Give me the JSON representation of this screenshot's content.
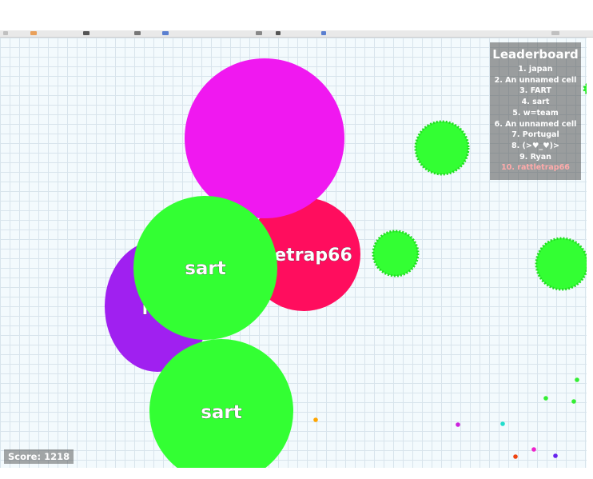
{
  "leaderboard": {
    "title": "Leaderboard",
    "entries": [
      "1. japan",
      "2. An unnamed cell",
      "3. FART",
      "4. sart",
      "5. w=team",
      "6. An unnamed cell",
      "7. Portugal",
      "8. (>♥_♥)>",
      "9. Ryan",
      "10. rattletrap66"
    ],
    "highlight_color": "#ffaaaa"
  },
  "score": {
    "text": "Score: 1218"
  },
  "cells": {
    "pink_big": {
      "color": "#f018f0"
    },
    "red_player": {
      "label": "etrap66",
      "color": "#ff0d5e"
    },
    "purple": {
      "label": "r",
      "color": "#a020f0"
    },
    "green_top": {
      "label": "sart",
      "color": "#33ff33"
    },
    "green_bottom": {
      "label": "sart",
      "color": "#33ff33"
    }
  },
  "viruses": {
    "color": "#33ff33",
    "edge_color": "#22dd22"
  }
}
